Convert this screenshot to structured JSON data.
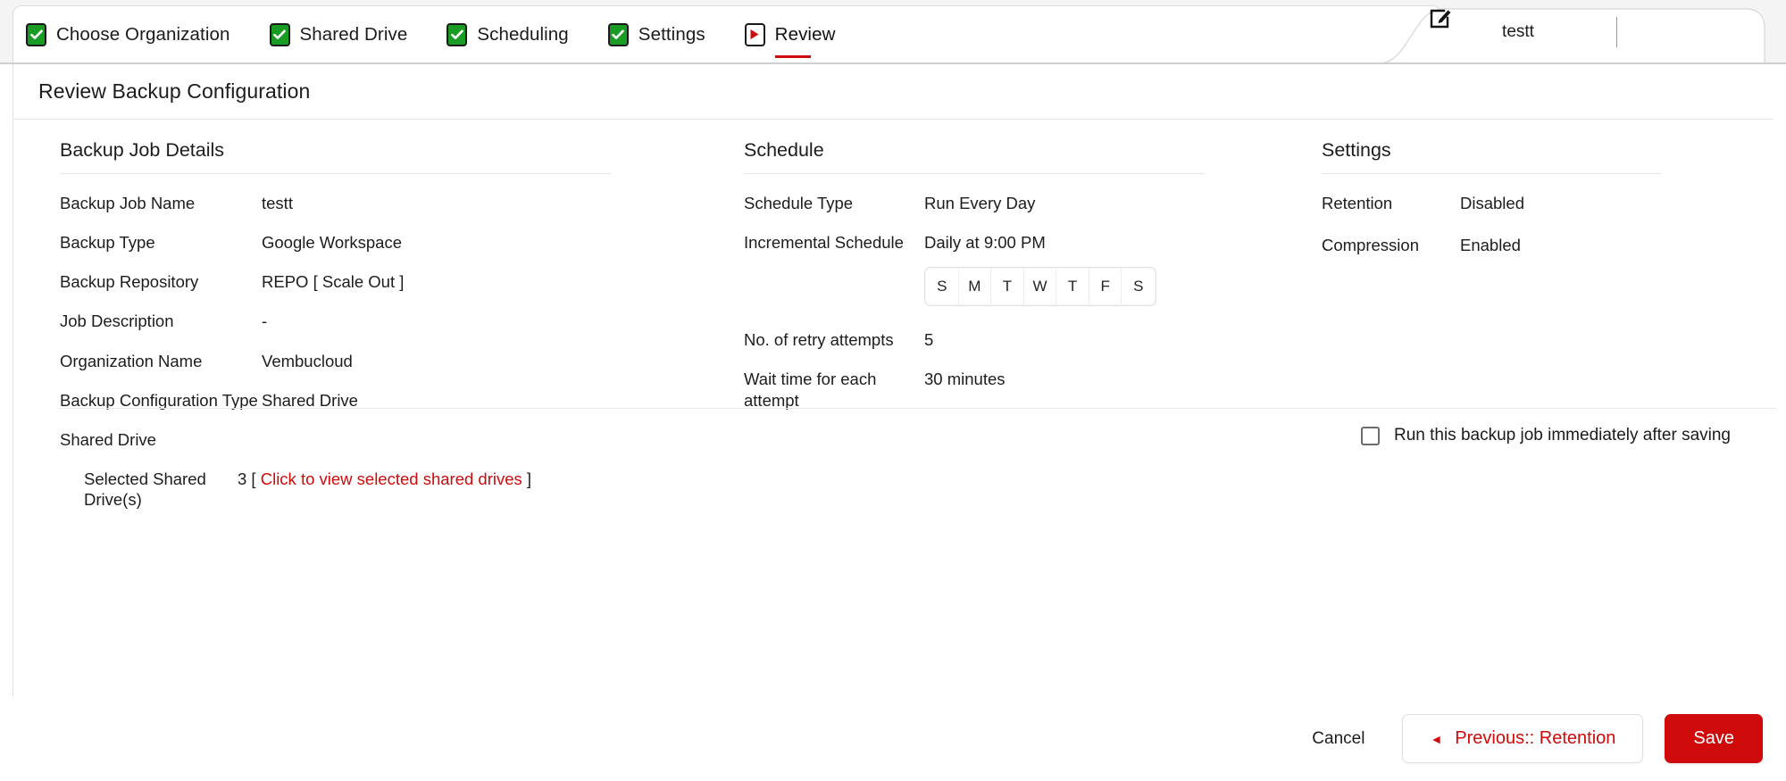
{
  "colors": {
    "brand_red": "#cf0a0a",
    "step_done_green": "#1a9b24",
    "text": "#1c1c1c",
    "header_bg": "#f4f4f4"
  },
  "steps": [
    {
      "label": "Choose Organization",
      "icon": "checkbox-checked-icon",
      "state": "done"
    },
    {
      "label": "Shared Drive",
      "icon": "checkbox-checked-icon",
      "state": "done"
    },
    {
      "label": "Scheduling",
      "icon": "checkbox-checked-icon",
      "state": "done"
    },
    {
      "label": "Settings",
      "icon": "checkbox-checked-icon",
      "state": "done"
    },
    {
      "label": "Review",
      "icon": "play-square-icon",
      "state": "current"
    }
  ],
  "tab": {
    "title": "testt",
    "edit_icon": "edit-square-icon"
  },
  "page": {
    "title": "Review Backup Configuration"
  },
  "details": {
    "heading": "Backup Job Details",
    "rows": [
      {
        "label": "Backup Job Name",
        "value": "testt"
      },
      {
        "label": "Backup Type",
        "value": "Google Workspace"
      },
      {
        "label": "Backup Repository",
        "value": "REPO [ Scale Out ]"
      },
      {
        "label": "Job Description",
        "value": "-"
      },
      {
        "label": "Organization Name",
        "value": "Vembucloud"
      },
      {
        "label": "Backup Configuration Type",
        "value": "Shared Drive"
      },
      {
        "label": "Shared Drive",
        "value": ""
      }
    ],
    "selected_drives": {
      "label": "Selected Shared Drive(s)",
      "count": "3",
      "prefix": "3 [ ",
      "link": "Click to view selected shared drives",
      "suffix": " ]"
    }
  },
  "schedule": {
    "heading": "Schedule",
    "rows": [
      {
        "label": "Schedule Type",
        "value": "Run Every Day"
      },
      {
        "label": "Incremental Schedule",
        "value": "Daily at 9:00 PM"
      }
    ],
    "days": [
      "S",
      "M",
      "T",
      "W",
      "T",
      "F",
      "S"
    ],
    "days_selected": [
      false,
      false,
      false,
      false,
      false,
      false,
      false
    ],
    "retry_rows": [
      {
        "label": "No. of retry attempts",
        "value": "5"
      },
      {
        "label": "Wait time for each attempt",
        "value": "30 minutes"
      }
    ]
  },
  "settings": {
    "heading": "Settings",
    "rows": [
      {
        "label": "Retention",
        "value": "Disabled"
      },
      {
        "label": "Compression",
        "value": "Enabled"
      }
    ]
  },
  "run_now": {
    "label": "Run this backup job immediately after saving",
    "checked": false
  },
  "footer": {
    "cancel": "Cancel",
    "previous": "Previous:: Retention",
    "previous_arrow": "◄",
    "save": "Save"
  }
}
